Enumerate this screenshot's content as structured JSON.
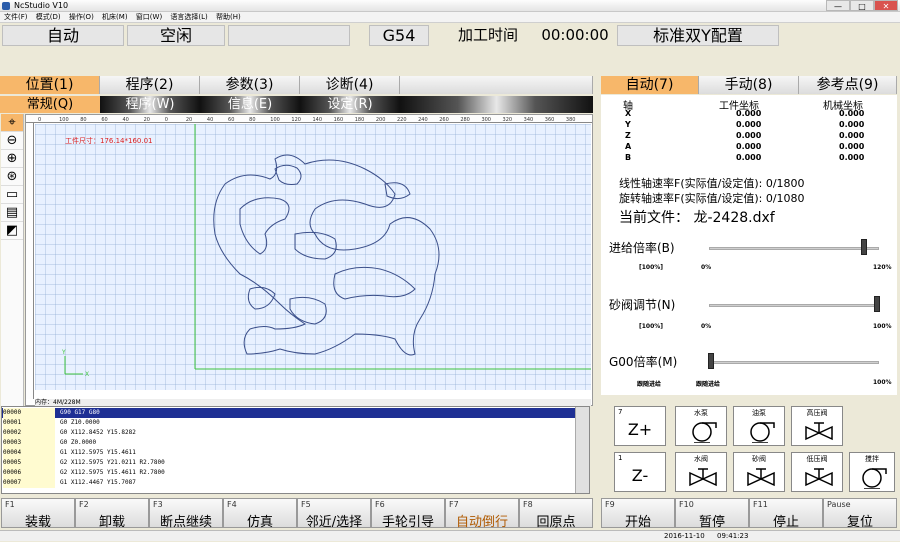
{
  "window": {
    "title": "NcStudio V10",
    "min": "—",
    "max": "□",
    "close": "✕"
  },
  "menu": [
    "文件(F)",
    "模式(D)",
    "操作(O)",
    "机床(M)",
    "窗口(W)",
    "语言选择(L)",
    "帮助(H)"
  ],
  "status": {
    "mode": "自动",
    "state": "空闲",
    "blank": "",
    "coord": "G54",
    "time_label": "加工时间",
    "time": "00:00:00",
    "config": "标准双Y配置"
  },
  "left_tabs": [
    "位置(1)",
    "程序(2)",
    "参数(3)",
    "诊断(4)"
  ],
  "sub_tabs": [
    "常规(Q)",
    "程序(W)",
    "信息(E)",
    "设定(R)"
  ],
  "right_tabs": [
    "自动(7)",
    "手动(8)",
    "参考点(9)"
  ],
  "canvas": {
    "work_size": "工件尺寸：176.14*160.01",
    "memory": "内存：4M/228M",
    "ruler": [
      "0",
      "100",
      "80",
      "60",
      "40",
      "20",
      "0",
      "20",
      "40",
      "60",
      "80",
      "100",
      "120",
      "140",
      "160",
      "180",
      "200",
      "220",
      "240",
      "260",
      "280",
      "300",
      "320",
      "340",
      "360",
      "380"
    ],
    "x_label": "X",
    "y_label": "Y"
  },
  "positions": {
    "h_axis": "轴",
    "h_work": "工件坐标",
    "h_mach": "机械坐标",
    "rows": [
      {
        "axis": "X",
        "work": "0.000",
        "mach": "0.000"
      },
      {
        "axis": "Y",
        "work": "0.000",
        "mach": "0.000"
      },
      {
        "axis": "Z",
        "work": "0.000",
        "mach": "0.000"
      },
      {
        "axis": "A",
        "work": "0.000",
        "mach": "0.000"
      },
      {
        "axis": "B",
        "work": "0.000",
        "mach": "0.000"
      }
    ]
  },
  "feed": {
    "linear": "线性轴速率F(实际值/设定值):  0/1800",
    "rotary": "旋转轴速率F(实际值/设定值):  0/1080",
    "file": "当前文件：  龙-2428.dxf"
  },
  "sliders": [
    {
      "label": "进给倍率(B)",
      "left": "[100%]",
      "mid": "0%",
      "right": "120%",
      "value": 0.92
    },
    {
      "label": "砂阀调节(N)",
      "left": "[100%]",
      "mid": "0%",
      "right": "100%",
      "value": 1.0
    },
    {
      "label": "G00倍率(M)",
      "left": "跟随进给",
      "mid": "跟随进给",
      "right": "100%",
      "value": 0.0
    }
  ],
  "code": [
    {
      "n": "00000",
      "t": "G90 G17 G80"
    },
    {
      "n": "00001",
      "t": "G0 Z10.0000"
    },
    {
      "n": "00002",
      "t": "G0 X112.8452 Y15.8282"
    },
    {
      "n": "00003",
      "t": "G0 Z0.0000"
    },
    {
      "n": "00004",
      "t": "G1 X112.5975 Y15.4611"
    },
    {
      "n": "00005",
      "t": "G2 X112.5975 Y21.0211 R2.7800"
    },
    {
      "n": "00006",
      "t": "G2 X112.5975 Y15.4611 R2.7800"
    },
    {
      "n": "00007",
      "t": "G1 X112.4467 Y15.7087"
    }
  ],
  "controls": {
    "z_plus_num": "7",
    "z_plus": "Z+",
    "z_minus_num": "1",
    "z_minus": "Z-",
    "water_pump": "水泵",
    "oil_pump": "油泵",
    "high_valve": "高压阀",
    "water_valve": "水阀",
    "sand_valve": "砂阀",
    "low_valve": "低压阀",
    "stir": "搅拌"
  },
  "fkeys": [
    {
      "k": "F1",
      "l": "装载"
    },
    {
      "k": "F2",
      "l": "卸载"
    },
    {
      "k": "F3",
      "l": "断点继续"
    },
    {
      "k": "F4",
      "l": "仿真"
    },
    {
      "k": "F5",
      "l": "邻近/选择"
    },
    {
      "k": "F6",
      "l": "手轮引导"
    },
    {
      "k": "F7",
      "l": "自动倒行"
    },
    {
      "k": "F8",
      "l": "回原点"
    },
    {
      "k": "F9",
      "l": "开始"
    },
    {
      "k": "F10",
      "l": "暂停"
    },
    {
      "k": "F11",
      "l": "停止"
    },
    {
      "k": "Pause",
      "l": "复位"
    }
  ],
  "statusbar": {
    "date": "2016-11-10",
    "time": "09:41:23"
  },
  "colors": {
    "active_tab": "#f7b76a",
    "selected_line": "#1e2f94",
    "drawing": "#3b4f8a"
  }
}
